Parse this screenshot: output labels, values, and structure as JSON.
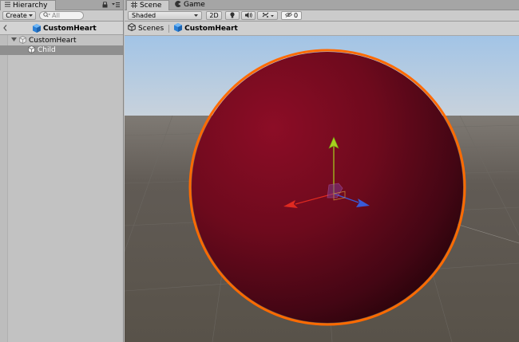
{
  "hierarchy": {
    "tab_label": "Hierarchy",
    "create_label": "Create",
    "search_placeholder": "All",
    "scene_title": "CustomHeart",
    "items": [
      {
        "label": "CustomHeart"
      },
      {
        "label": "Child"
      }
    ]
  },
  "scene_view": {
    "tabs": [
      {
        "label": "Scene"
      },
      {
        "label": "Game"
      }
    ],
    "draw_mode": "Shaded",
    "toggle_2d": "2D",
    "hidden_count": "0",
    "breadcrumb": {
      "root": "Scenes",
      "current": "CustomHeart"
    }
  },
  "colors": {
    "sphere_dark": "#3a0612",
    "sphere_light": "#8a0c25",
    "selection_outline": "#ff6a00",
    "sky_top": "#9fc2e6",
    "ground": "#5e5851",
    "gizmo_x": "#e02a20",
    "gizmo_y": "#a6d21e",
    "gizmo_z": "#3a5ad8"
  }
}
